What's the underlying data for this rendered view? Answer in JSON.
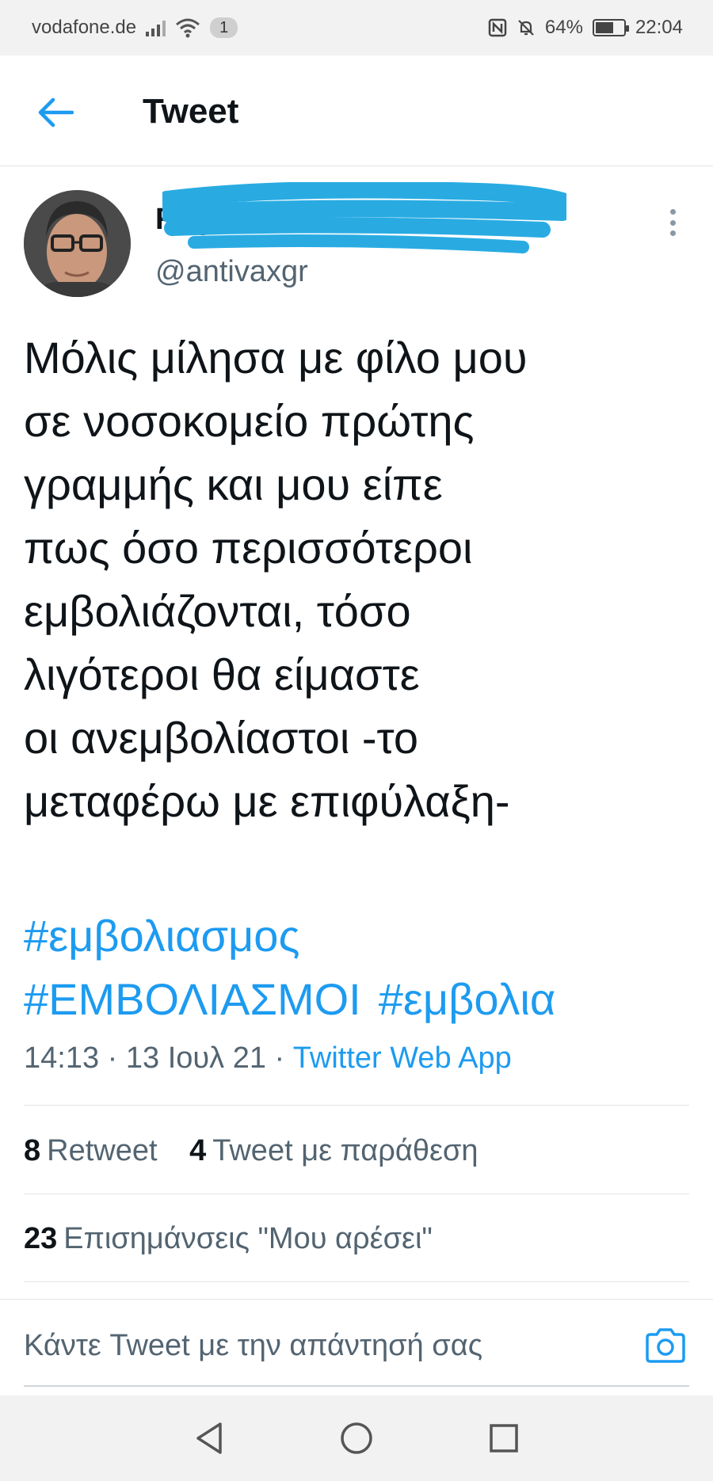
{
  "status_bar": {
    "carrier": "vodafone.de",
    "sim_badge": "1",
    "battery": "64%",
    "time": "22:04"
  },
  "header": {
    "title": "Tweet"
  },
  "tweet": {
    "display_name": "Rag",
    "handle": "@antivaxgr",
    "text_lines": [
      "Μόλις μίλησα με φίλο μου",
      "σε νοσοκομείο πρώτης",
      "γραμμής και μου είπε",
      "πως όσο περισσότεροι",
      "εμβολιάζονται, τόσο",
      "λιγότεροι θα είμαστε",
      "οι ανεμβολίαστοι -το",
      "μεταφέρω με επιφύλαξη-"
    ],
    "hashtags": [
      "#εμβολιασμος",
      "#ΕΜΒΟΛΙΑΣΜΟΙ",
      "#εμβολια"
    ],
    "time_date": "14:13 · 13 Ιουλ 21 · ",
    "source_app": "Twitter Web App"
  },
  "stats": {
    "retweets_count": "8",
    "retweets_label": "Retweet",
    "quotes_count": "4",
    "quotes_label": "Tweet με παράθεση",
    "likes_count": "23",
    "likes_label": "Επισημάνσεις \"Μου αρέσει\""
  },
  "reply": {
    "placeholder": "Κάντε Tweet με την απάντησή σας"
  },
  "colors": {
    "accent": "#1d9bf0",
    "redaction": "#29abe2"
  },
  "icons": {
    "back": "arrow-left-icon",
    "more": "more-vertical-icon",
    "camera": "camera-icon",
    "nav_back": "triangle-back-icon",
    "nav_home": "circle-home-icon",
    "nav_recents": "square-recents-icon"
  }
}
